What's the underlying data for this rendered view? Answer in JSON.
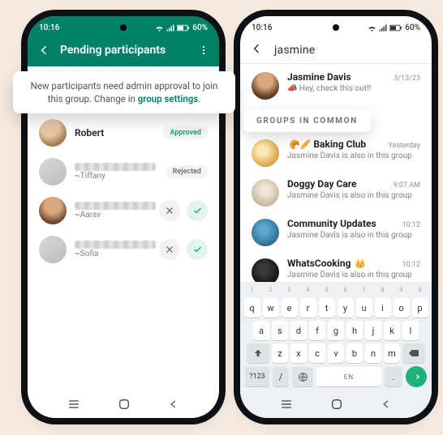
{
  "status": {
    "time": "10:16",
    "battery": "60%"
  },
  "left": {
    "header_title": "Pending participants",
    "tip_prefix": "New participants need admin approval to join this group. Change in ",
    "tip_link": "group settings",
    "tip_suffix": ".",
    "rows": [
      {
        "name": "Robert",
        "sub": "",
        "status": "Approved",
        "status_kind": "approved",
        "blurred": false
      },
      {
        "name": "",
        "sub": "~Tiffany",
        "status": "Rejected",
        "status_kind": "rejected",
        "blurred": true
      },
      {
        "name": "",
        "sub": "~Aarav",
        "status": "",
        "status_kind": "decide",
        "blurred": true
      },
      {
        "name": "",
        "sub": "~Sofia",
        "status": "",
        "status_kind": "decide",
        "blurred": true
      }
    ]
  },
  "right": {
    "search_query": "jasmine",
    "contact": {
      "name": "Jasmine Davis",
      "sub": "📣 Hey, check this out!!",
      "time": "3/13/23"
    },
    "groups_label": "GROUPS IN COMMON",
    "group_subtext": "Jasmine Davis is also in this group",
    "groups": [
      {
        "name": "Baking Club",
        "emoji": "🥐🥖",
        "time": "Yesterday"
      },
      {
        "name": "Doggy Day Care",
        "emoji": "",
        "time": "9:07 AM"
      },
      {
        "name": "Community Updates",
        "emoji": "",
        "time": "10:12"
      },
      {
        "name": "WhatsCooking",
        "emoji": "👑",
        "time": "10:12"
      }
    ]
  },
  "keyboard": {
    "row1": [
      "q",
      "w",
      "e",
      "r",
      "t",
      "y",
      "u",
      "i",
      "o",
      "p"
    ],
    "row2": [
      "a",
      "s",
      "d",
      "f",
      "g",
      "h",
      "j",
      "k",
      "l"
    ],
    "row3": [
      "z",
      "x",
      "c",
      "v",
      "b",
      "n",
      "m"
    ],
    "sym": "?123",
    "lang": "EN",
    "slash": "/",
    "dot": "."
  }
}
